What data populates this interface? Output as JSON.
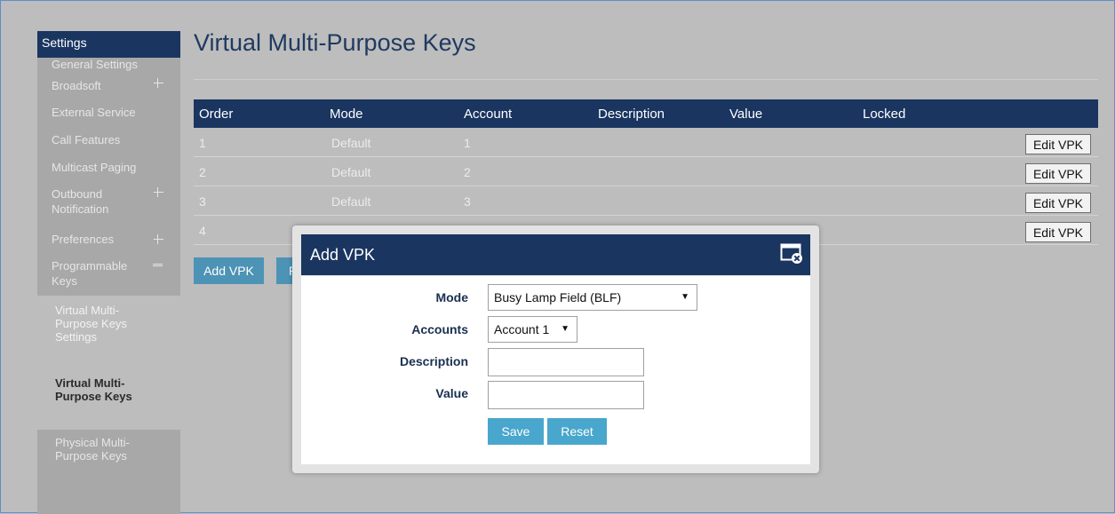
{
  "sidebar": {
    "header": "Settings",
    "items": [
      {
        "label": "General Settings"
      },
      {
        "label": "Broadsoft"
      },
      {
        "label": "External Service"
      },
      {
        "label": "Call Features"
      },
      {
        "label": "Multicast Paging"
      },
      {
        "label": "Outbound Notification"
      },
      {
        "label": "Preferences"
      },
      {
        "label": "Programmable Keys"
      }
    ],
    "sub_items": [
      {
        "label": "Virtual Multi-Purpose Keys Settings"
      },
      {
        "label": "Virtual Multi-Purpose Keys"
      },
      {
        "label": "Physical Multi-Purpose Keys"
      }
    ]
  },
  "main": {
    "title": "Virtual Multi-Purpose Keys",
    "table": {
      "headers": [
        "Order",
        "Mode",
        "Account",
        "Description",
        "Value",
        "Locked"
      ],
      "rows": [
        {
          "order": "1",
          "mode": "Default",
          "account": "1",
          "action": "Edit VPK"
        },
        {
          "order": "2",
          "mode": "Default",
          "account": "2",
          "action": "Edit VPK"
        },
        {
          "order": "3",
          "mode": "Default",
          "account": "3",
          "action": "Edit VPK"
        },
        {
          "order": "4",
          "mode": "",
          "account": "",
          "action": "Edit VPK"
        }
      ]
    },
    "add_button": "Add VPK",
    "second_button_partial": "R"
  },
  "modal": {
    "title": "Add VPK",
    "fields": {
      "mode_label": "Mode",
      "mode_value": "Busy Lamp Field (BLF)",
      "accounts_label": "Accounts",
      "accounts_value": "Account 1",
      "description_label": "Description",
      "description_value": "",
      "value_label": "Value",
      "value_value": ""
    },
    "save_label": "Save",
    "reset_label": "Reset",
    "close_icon": "window-close-icon"
  },
  "colors": {
    "navy": "#1a3560",
    "overlay_gray": "#bdbdbd",
    "button_blue": "#49a6cc"
  }
}
